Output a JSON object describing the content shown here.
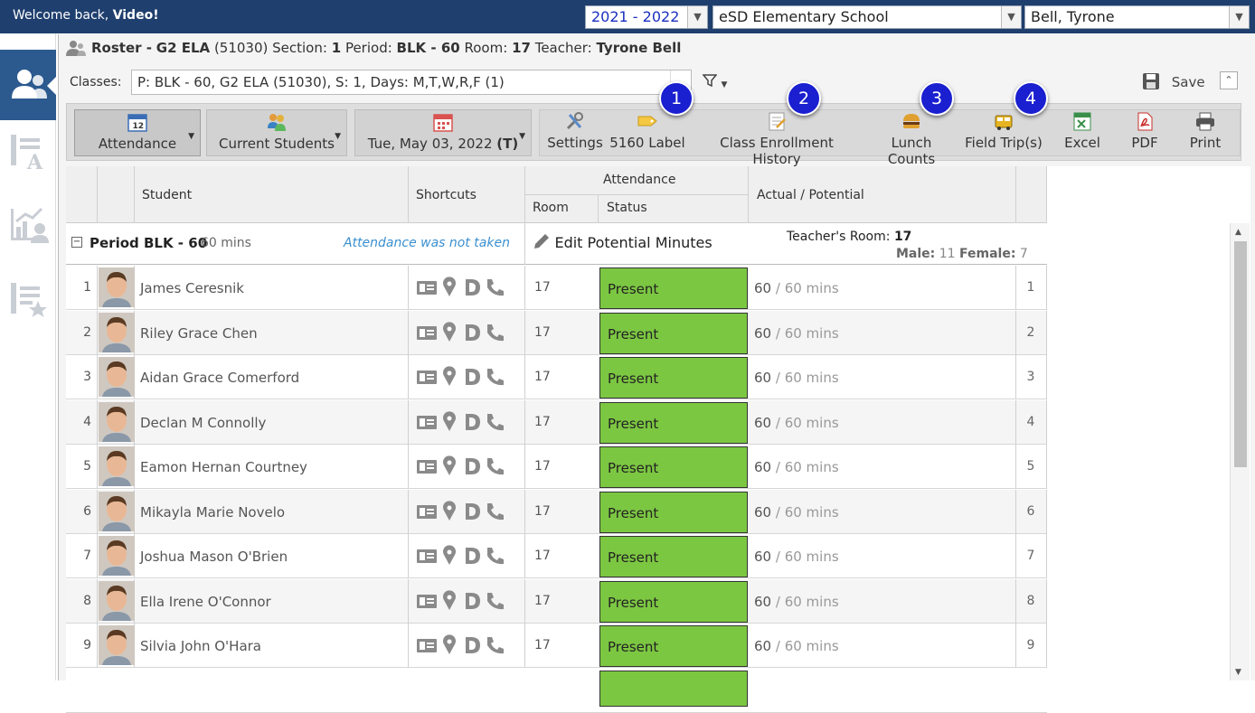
{
  "topbar": {
    "welcome_prefix": "Welcome back,",
    "welcome_name": "Video!",
    "year": "2021 - 2022",
    "school": "eSD Elementary School",
    "teacher": "Bell, Tyrone"
  },
  "title": {
    "roster_label": "Roster -",
    "course": "G2 ELA",
    "course_id": "(51030)",
    "section_label": "Section:",
    "section": "1",
    "period_label": "Period:",
    "period": "BLK - 60",
    "room_label": "Room:",
    "room": "17",
    "teacher_label": "Teacher:",
    "teacher": "Tyrone Bell"
  },
  "classes": {
    "label": "Classes:",
    "value": "P: BLK - 60, G2 ELA (51030), S: 1, Days: M,T,W,R,F (1)",
    "save_label": "Save"
  },
  "toolbar": {
    "attendance": "Attendance",
    "current_students": "Current Students",
    "date": "Tue, May 03, 2022",
    "date_suffix": "(T)",
    "settings": "Settings",
    "label_5160": "5160 Label",
    "enrollment_history": "Class Enrollment History",
    "lunch_counts": "Lunch Counts",
    "field_trips": "Field Trip(s)",
    "excel": "Excel",
    "pdf": "PDF",
    "print": "Print"
  },
  "badges": [
    "1",
    "2",
    "3",
    "4"
  ],
  "grid": {
    "headers": {
      "student": "Student",
      "shortcuts": "Shortcuts",
      "attendance": "Attendance",
      "room": "Room",
      "status": "Status",
      "actual_potential": "Actual / Potential"
    },
    "group": {
      "period_label": "Period BLK - 60",
      "period_mins": "60 mins",
      "note": "Attendance was not taken",
      "edit_minutes": "Edit Potential Minutes",
      "teacher_room_label": "Teacher's Room:",
      "teacher_room": "17",
      "male_label": "Male:",
      "male": "11",
      "female_label": "Female:",
      "female": "7"
    },
    "rows": [
      {
        "num": "1",
        "name": "James Ceresnik",
        "room": "17",
        "status": "Present",
        "actual": "60",
        "potential": "/ 60 mins",
        "right": "1"
      },
      {
        "num": "2",
        "name": "Riley Grace Chen",
        "room": "17",
        "status": "Present",
        "actual": "60",
        "potential": "/ 60 mins",
        "right": "2"
      },
      {
        "num": "3",
        "name": "Aidan Grace Comerford",
        "room": "17",
        "status": "Present",
        "actual": "60",
        "potential": "/ 60 mins",
        "right": "3"
      },
      {
        "num": "4",
        "name": "Declan M Connolly",
        "room": "17",
        "status": "Present",
        "actual": "60",
        "potential": "/ 60 mins",
        "right": "4"
      },
      {
        "num": "5",
        "name": "Eamon Hernan Courtney",
        "room": "17",
        "status": "Present",
        "actual": "60",
        "potential": "/ 60 mins",
        "right": "5"
      },
      {
        "num": "6",
        "name": "Mikayla Marie Novelo",
        "room": "17",
        "status": "Present",
        "actual": "60",
        "potential": "/ 60 mins",
        "right": "6"
      },
      {
        "num": "7",
        "name": "Joshua Mason O'Brien",
        "room": "17",
        "status": "Present",
        "actual": "60",
        "potential": "/ 60 mins",
        "right": "7"
      },
      {
        "num": "8",
        "name": "Ella Irene O'Connor",
        "room": "17",
        "status": "Present",
        "actual": "60",
        "potential": "/ 60 mins",
        "right": "8"
      },
      {
        "num": "9",
        "name": "Silvia John O'Hara",
        "room": "17",
        "status": "Present",
        "actual": "60",
        "potential": "/ 60 mins",
        "right": "9"
      }
    ]
  },
  "colors": {
    "topbar": "#1f3f6e",
    "present": "#7cc742",
    "badge": "#1a1fd0",
    "note": "#3a8fd0"
  }
}
